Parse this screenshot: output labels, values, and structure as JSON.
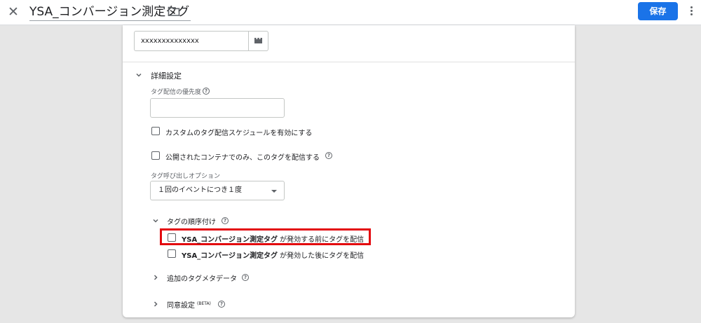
{
  "header": {
    "title": "YSA_コンバージョン測定タグ",
    "save_label": "保存"
  },
  "id_field": {
    "value": "xxxxxxxxxxxxxx"
  },
  "advanced": {
    "title": "詳細設定",
    "priority_label": "タグ配信の優先度",
    "priority_value": "",
    "custom_schedule_label": "カスタムのタグ配信スケジュールを有効にする",
    "published_only_label": "公開されたコンテナでのみ、このタグを配信する",
    "firing_options_label": "タグ呼び出しオプション",
    "firing_options_value": "１回のイベントにつき１度"
  },
  "sequencing": {
    "title": "タグの順序付け",
    "before": {
      "tag_name": "YSA_コンバージョン測定タグ",
      "suffix": " が発効する前にタグを配信"
    },
    "after": {
      "tag_name": "YSA_コンバージョン測定タグ",
      "suffix": " が発効した後にタグを配信"
    }
  },
  "metadata": {
    "title": "追加のタグメタデータ"
  },
  "consent": {
    "title": "同意設定",
    "badge": "(BETA)"
  },
  "colors": {
    "primary": "#1a73e8",
    "highlight": "#e3070e",
    "background": "#e6e6e6"
  }
}
